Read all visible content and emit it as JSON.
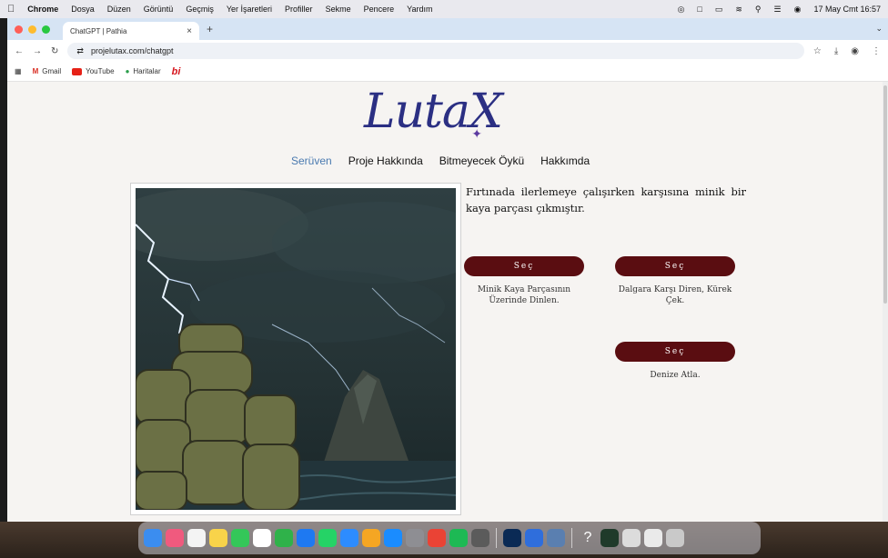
{
  "menubar": {
    "app": "Chrome",
    "items": [
      "Dosya",
      "Düzen",
      "Görüntü",
      "Geçmiş",
      "Yer İşaretleri",
      "Profiller",
      "Sekme",
      "Pencere",
      "Yardım"
    ],
    "datetime": "17 May Cmt  16:57"
  },
  "browser": {
    "tab_title": "ChatGPT | Pathia",
    "url": "projelutax.com/chatgpt",
    "bookmarks": [
      "Gmail",
      "YouTube",
      "Haritalar",
      "bi"
    ]
  },
  "site": {
    "logo": "LutaX",
    "nav": [
      "Serüven",
      "Proje Hakkında",
      "Bitmeyecek Öykü",
      "Hakkımda"
    ],
    "active_nav": "Serüven",
    "story": "Fırtınada ilerlemeye çalışırken karşısına minik bir kaya parçası çıkmıştır.",
    "choices": [
      {
        "button": "Seç",
        "label": "Minik Kaya Parçasının Üzerinde Dinlen."
      },
      {
        "button": "Seç",
        "label": "Dalgara Karşı Diren, Kürek Çek."
      },
      {
        "button": "Seç",
        "label": "Denize Atla."
      }
    ]
  },
  "colors": {
    "logo": "#2b2f83",
    "nav_active": "#4a7ab0",
    "button": "#5a0d11",
    "page_bg": "#f6f4f2"
  }
}
